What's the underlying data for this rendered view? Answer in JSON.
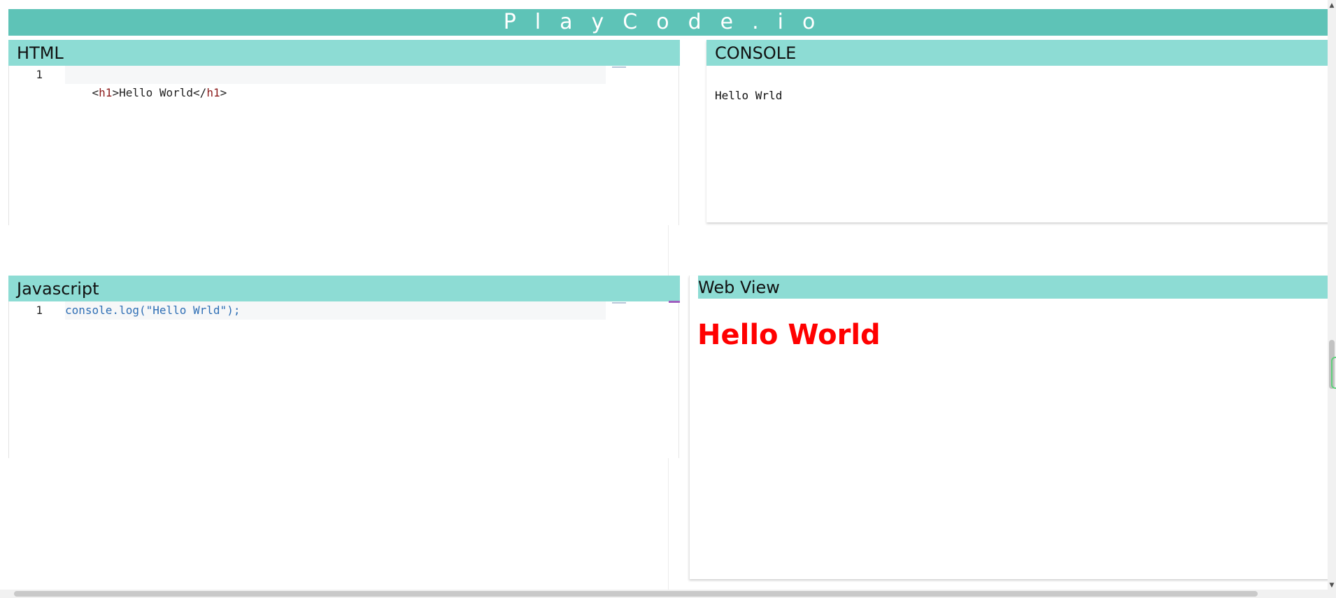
{
  "banner": {
    "title": "PlayCode.io"
  },
  "html_panel": {
    "header": "HTML",
    "lines": [
      {
        "number": "1",
        "open_bracket": "<",
        "open_tag": "h1",
        "open_close": ">",
        "text": "Hello World",
        "close_bracket": "</",
        "close_tag": "h1",
        "close_close": ">"
      }
    ]
  },
  "console_panel": {
    "header": "CONSOLE",
    "output": "Hello Wrld"
  },
  "js_panel": {
    "header": "Javascript",
    "lines": [
      {
        "number": "1",
        "code": "console.log(\"Hello Wrld\");"
      }
    ]
  },
  "webview_panel": {
    "header": "Web View",
    "rendered_h1": "Hello World"
  },
  "colors": {
    "banner": "#5ec3b7",
    "panel_header": "#8ddcd4",
    "rendered_h1": "#ff0000",
    "html_tag": "#8b1a1a",
    "js_code": "#2f6fb5"
  }
}
